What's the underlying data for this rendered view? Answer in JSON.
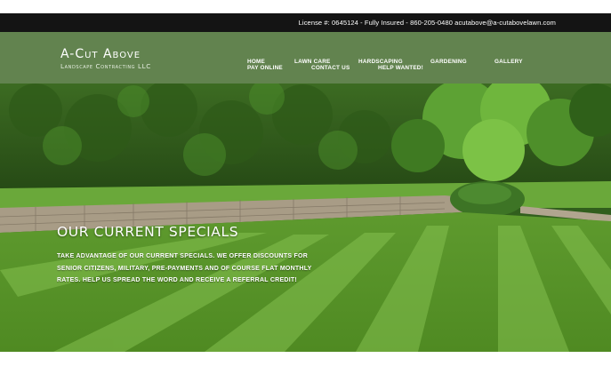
{
  "topbar": {
    "info": "License #: 0645124 - Fully Insured - 860-205-0480 acutabove@a-cutabovelawn.com"
  },
  "logo": {
    "title": "A-Cut Above",
    "subtitle": "Landscape Contracting LLC"
  },
  "nav": {
    "items": [
      {
        "label": "HOME"
      },
      {
        "label": "LAWN CARE"
      },
      {
        "label": "HARDSCAPING"
      },
      {
        "label": "GARDENING"
      },
      {
        "label": "GALLERY"
      },
      {
        "label": "PAY ONLINE"
      },
      {
        "label": "CONTACT US"
      },
      {
        "label": "HELP WANTED!"
      }
    ]
  },
  "hero": {
    "title": "OUR CURRENT SPECIALS",
    "body": "TAKE ADVANTAGE OF OUR CURRENT SPECIALS.  WE OFFER DISCOUNTS FOR SENIOR CITIZENS, MILITARY, PRE-PAYMENTS AND OF COURSE FLAT MONTHLY RATES.  HELP US SPREAD THE WORD AND RECEIVE A REFERRAL CREDIT!"
  },
  "colors": {
    "header_bg": "#62834f",
    "topbar_bg": "#141414"
  }
}
